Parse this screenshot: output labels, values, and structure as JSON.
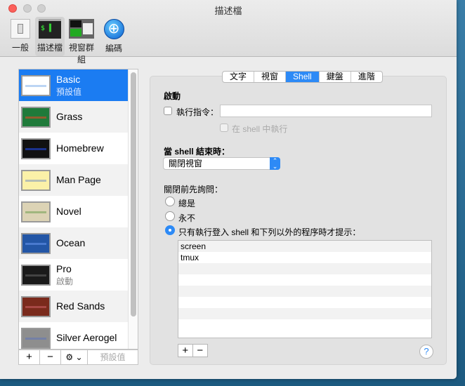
{
  "window": {
    "title": "描述檔"
  },
  "toolbar": [
    {
      "label": "一般",
      "icon": "general-icon"
    },
    {
      "label": "描述檔",
      "icon": "profiles-icon",
      "selected": true
    },
    {
      "label": "視窗群組",
      "icon": "window-groups-icon"
    },
    {
      "label": "編碼",
      "icon": "encodings-icon"
    }
  ],
  "profiles": [
    {
      "name": "Basic",
      "sub": "預設值",
      "color": "#ffffff",
      "accent": "#9fc3ef"
    },
    {
      "name": "Grass",
      "color": "#1f7a3a",
      "accent": "#c0502a"
    },
    {
      "name": "Homebrew",
      "color": "#111111",
      "accent": "#2040c0"
    },
    {
      "name": "Man Page",
      "color": "#fbf1a8",
      "accent": "#9ab"
    },
    {
      "name": "Novel",
      "color": "#dcd3b5",
      "accent": "#8a6"
    },
    {
      "name": "Ocean",
      "color": "#2356a6",
      "accent": "#5a8ae0"
    },
    {
      "name": "Pro",
      "sub": "啟動",
      "color": "#1a1a1a",
      "accent": "#555"
    },
    {
      "name": "Red Sands",
      "color": "#7a2a1c",
      "accent": "#b55"
    },
    {
      "name": "Silver Aerogel",
      "color": "#8e8e8e",
      "accent": "#6a7ab0"
    }
  ],
  "list_buttons": {
    "add": "+",
    "remove": "−",
    "gear": "⚙ ⌄",
    "default": "預設值"
  },
  "tabs": [
    {
      "label": "文字"
    },
    {
      "label": "視窗"
    },
    {
      "label": "Shell",
      "active": true
    },
    {
      "label": "鍵盤"
    },
    {
      "label": "進階"
    }
  ],
  "shell": {
    "startup_heading": "啟動",
    "run_command_label": "執行指令：",
    "run_command_value": "",
    "run_in_shell_label": "在 shell 中執行",
    "on_exit_heading": "當 shell 結束時：",
    "on_exit_value": "關閉視窗",
    "ask_heading": "關閉前先詢問：",
    "ask_options": [
      {
        "label": "總是"
      },
      {
        "label": "永不"
      },
      {
        "label": "只有執行登入 shell 和下列以外的程序時才提示：",
        "selected": true
      }
    ],
    "processes": [
      "screen",
      "tmux"
    ],
    "add": "+",
    "remove": "−",
    "help": "?"
  }
}
